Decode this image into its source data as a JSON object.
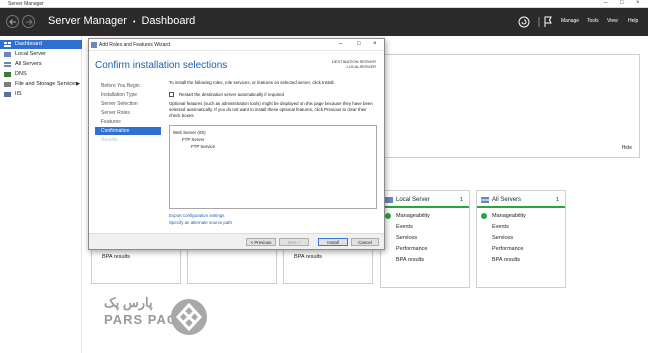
{
  "window": {
    "title": "Server Manager"
  },
  "header": {
    "breadcrumb_app": "Server Manager",
    "breadcrumb_sep": "•",
    "breadcrumb_page": "Dashboard",
    "menus": [
      "Manage",
      "Tools",
      "View",
      "Help"
    ]
  },
  "sidebar": {
    "items": [
      {
        "label": "Dashboard",
        "icon": "dashboard-icon",
        "active": true
      },
      {
        "label": "Local Server",
        "icon": "server-icon"
      },
      {
        "label": "All Servers",
        "icon": "servers-icon"
      },
      {
        "label": "DNS",
        "icon": "dns-icon"
      },
      {
        "label": "File and Storage Services",
        "icon": "storage-icon",
        "expand": "▶"
      },
      {
        "label": "IIS",
        "icon": "iis-icon"
      }
    ]
  },
  "welcome": {
    "hide": "Hide"
  },
  "tiles": {
    "local_server": {
      "name": "Local Server",
      "count": "1",
      "rows": [
        "Manageability",
        "Events",
        "Services",
        "Performance",
        "BPA results"
      ]
    },
    "all_servers": {
      "name": "All Servers",
      "count": "1",
      "rows": [
        "Manageability",
        "Events",
        "Services",
        "Performance",
        "BPA results"
      ]
    },
    "lower": [
      "BPA results",
      "",
      "BPA results"
    ]
  },
  "wizard": {
    "title": "Add Roles and Features Wizard",
    "heading": "Confirm installation selections",
    "destination_label": "DESTINATION SERVER",
    "destination_value": "LOCALSERVER",
    "steps": [
      {
        "label": "Before You Begin",
        "state": "normal"
      },
      {
        "label": "Installation Type",
        "state": "normal"
      },
      {
        "label": "Server Selection",
        "state": "normal"
      },
      {
        "label": "Server Roles",
        "state": "normal"
      },
      {
        "label": "Features",
        "state": "normal"
      },
      {
        "label": "Confirmation",
        "state": "active"
      },
      {
        "label": "Results",
        "state": "disabled"
      }
    ],
    "intro": "To install the following roles, role services, or features on selected server, click Install.",
    "restart_label": "Restart the destination server automatically if required",
    "optional_text": "Optional features (such as administration tools) might be displayed on this page because they have been selected automatically. If you do not want to install these optional features, click Previous to clear their check boxes.",
    "features": [
      "Web Server (IIS)",
      "FTP Server",
      "FTP Service"
    ],
    "links": [
      "Export configuration settings",
      "Specify an alternate source path"
    ],
    "buttons": {
      "previous": "< Previous",
      "next": "Next >",
      "install": "Install",
      "cancel": "Cancel"
    }
  },
  "watermark": {
    "brand": "PARS PACK",
    "brand_fa": "پارس پک"
  }
}
